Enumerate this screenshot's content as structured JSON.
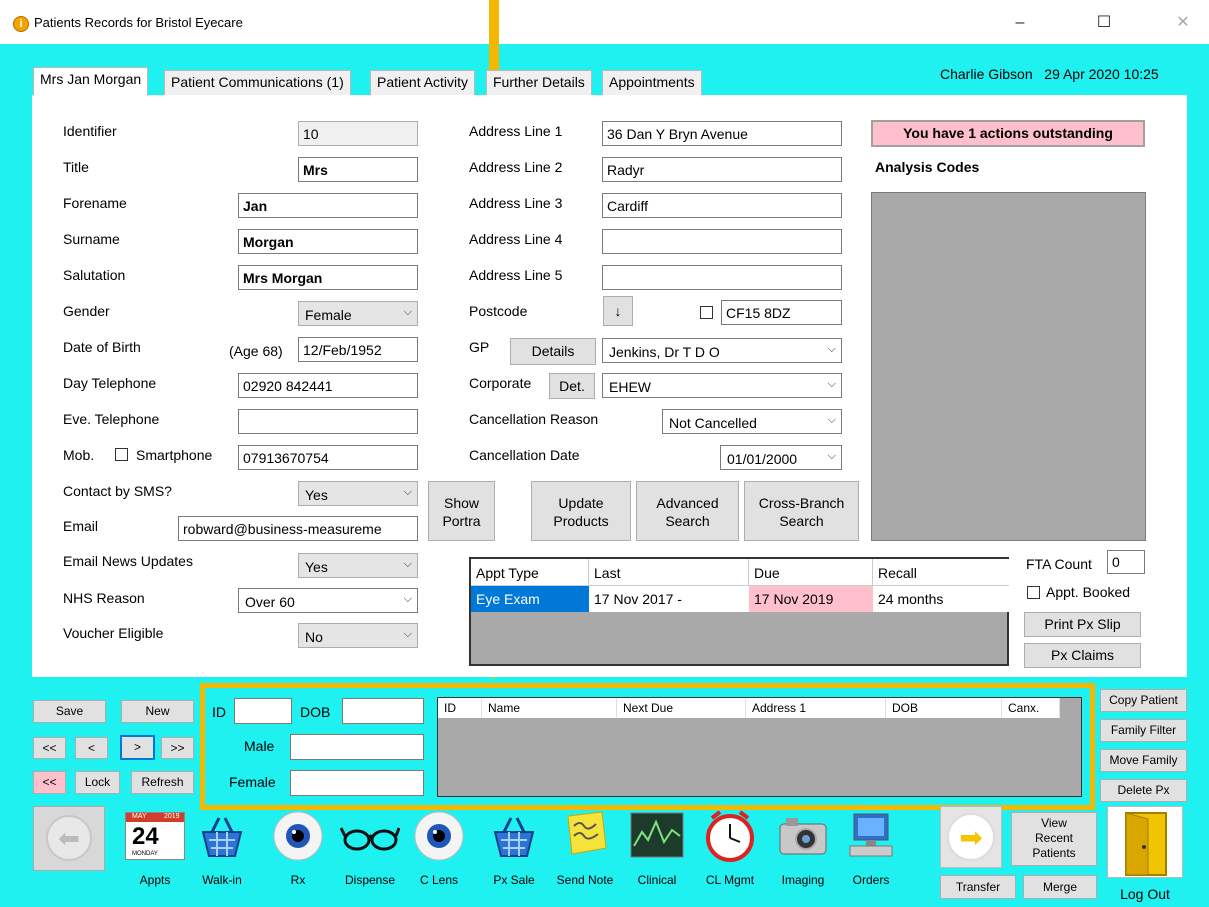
{
  "window": {
    "title": "Patients Records for Bristol Eyecare",
    "minimize": "–",
    "maximize": "☐",
    "close": "✕"
  },
  "header": {
    "user": "Charlie Gibson",
    "datetime": "29 Apr 2020 10:25"
  },
  "tabs": [
    {
      "label": "Mrs Jan Morgan"
    },
    {
      "label": "Patient Communications (1)"
    },
    {
      "label": "Patient Activity"
    },
    {
      "label": "Further Details"
    },
    {
      "label": "Appointments"
    }
  ],
  "patient": {
    "identifier_label": "Identifier",
    "identifier": "10",
    "title_label": "Title",
    "title": "Mrs",
    "forename_label": "Forename",
    "forename": "Jan",
    "surname_label": "Surname",
    "surname": "Morgan",
    "salutation_label": "Salutation",
    "salutation": "Mrs Morgan",
    "gender_label": "Gender",
    "gender": "Female",
    "dob_label": "Date of Birth",
    "age": "(Age 68)",
    "dob": "12/Feb/1952",
    "day_tel_label": "Day Telephone",
    "day_tel": "02920 842441",
    "eve_tel_label": "Eve. Telephone",
    "eve_tel": "",
    "mob_label": "Mob.",
    "smartphone_label": "Smartphone",
    "mob": "07913670754",
    "sms_label": "Contact by SMS?",
    "sms": "Yes",
    "email_label": "Email",
    "email": "robward@business-measureme",
    "news_label": "Email News Updates",
    "news": "Yes",
    "nhs_label": "NHS Reason",
    "nhs": "Over 60",
    "voucher_label": "Voucher Eligible",
    "voucher": "No"
  },
  "address": {
    "line1_label": "Address Line 1",
    "line1": "36 Dan Y Bryn Avenue",
    "line2_label": "Address Line 2",
    "line2": "Radyr",
    "line3_label": "Address Line 3",
    "line3": "Cardiff",
    "line4_label": "Address Line 4",
    "line4": "",
    "line5_label": "Address Line 5",
    "line5": "",
    "postcode_label": "Postcode",
    "postcode_btn": "↓",
    "postcode": "CF15 8DZ",
    "gp_label": "GP",
    "gp_details_btn": "Details",
    "gp": "Jenkins, Dr T D O",
    "corporate_label": "Corporate",
    "corporate_btn": "Det.",
    "corporate": "EHEW",
    "cancel_reason_label": "Cancellation Reason",
    "cancel_reason": "Not Cancelled",
    "cancel_date_label": "Cancellation Date",
    "cancel_date": "01/01/2000"
  },
  "actions": {
    "outstanding": "You have 1 actions outstanding",
    "analysis_codes": "Analysis Codes",
    "show_portrait_1": "Show",
    "show_portrait_2": "Portra",
    "update_1": "Update",
    "update_2": "Products",
    "advanced_1": "Advanced",
    "advanced_2": "Search",
    "cross_1": "Cross-Branch",
    "cross_2": "Search"
  },
  "recall_grid": {
    "headers": [
      "Appt Type",
      "Last",
      "Due",
      "Recall"
    ],
    "rows": [
      [
        "Eye Exam",
        "17 Nov 2017 -",
        "17 Nov 2019",
        "24 months"
      ]
    ]
  },
  "fta": {
    "label": "FTA Count",
    "value": "0",
    "booked": "Appt. Booked",
    "print": "Print Px Slip",
    "claims": "Px Claims"
  },
  "nav": {
    "save": "Save",
    "new": "New",
    "first": "<<",
    "prev": "<",
    "next": ">",
    "last": ">>",
    "back": "<<",
    "lock": "Lock",
    "refresh": "Refresh"
  },
  "search": {
    "id_label": "ID",
    "dob_label": "DOB",
    "male_label": "Male",
    "female_label": "Female",
    "id": "",
    "dob": "",
    "male": "",
    "female": "",
    "headers": [
      "ID",
      "Name",
      "Next Due",
      "Address 1",
      "DOB",
      "Canx."
    ]
  },
  "right_buttons": [
    "Copy Patient",
    "Family Filter",
    "Move Family",
    "Delete Px"
  ],
  "toolbar": [
    {
      "label": "Appts",
      "icon": "calendar-icon",
      "cal_month": "MAY",
      "cal_year": "2019",
      "cal_day": "24",
      "cal_weekday": "MONDAY"
    },
    {
      "label": "Walk-in",
      "icon": "basket-icon"
    },
    {
      "label": "Rx",
      "icon": "eye-icon"
    },
    {
      "label": "Dispense",
      "icon": "glasses-icon"
    },
    {
      "label": "C Lens",
      "icon": "eye-icon"
    },
    {
      "label": "Px Sale",
      "icon": "basket-icon"
    },
    {
      "label": "Send Note",
      "icon": "note-icon"
    },
    {
      "label": "Clinical",
      "icon": "clinical-chart-icon"
    },
    {
      "label": "CL Mgmt",
      "icon": "clock-icon"
    },
    {
      "label": "Imaging",
      "icon": "camera-icon"
    },
    {
      "label": "Orders",
      "icon": "computer-icon"
    }
  ],
  "bottom_right": {
    "view_1": "View",
    "view_2": "Recent",
    "view_3": "Patients",
    "transfer": "Transfer",
    "merge": "Merge",
    "logout": "Log Out"
  },
  "colors": {
    "background": "#1ff1f1",
    "highlight": "#f5b800",
    "overdue": "#ffc0cb",
    "selected": "#0078d7"
  }
}
